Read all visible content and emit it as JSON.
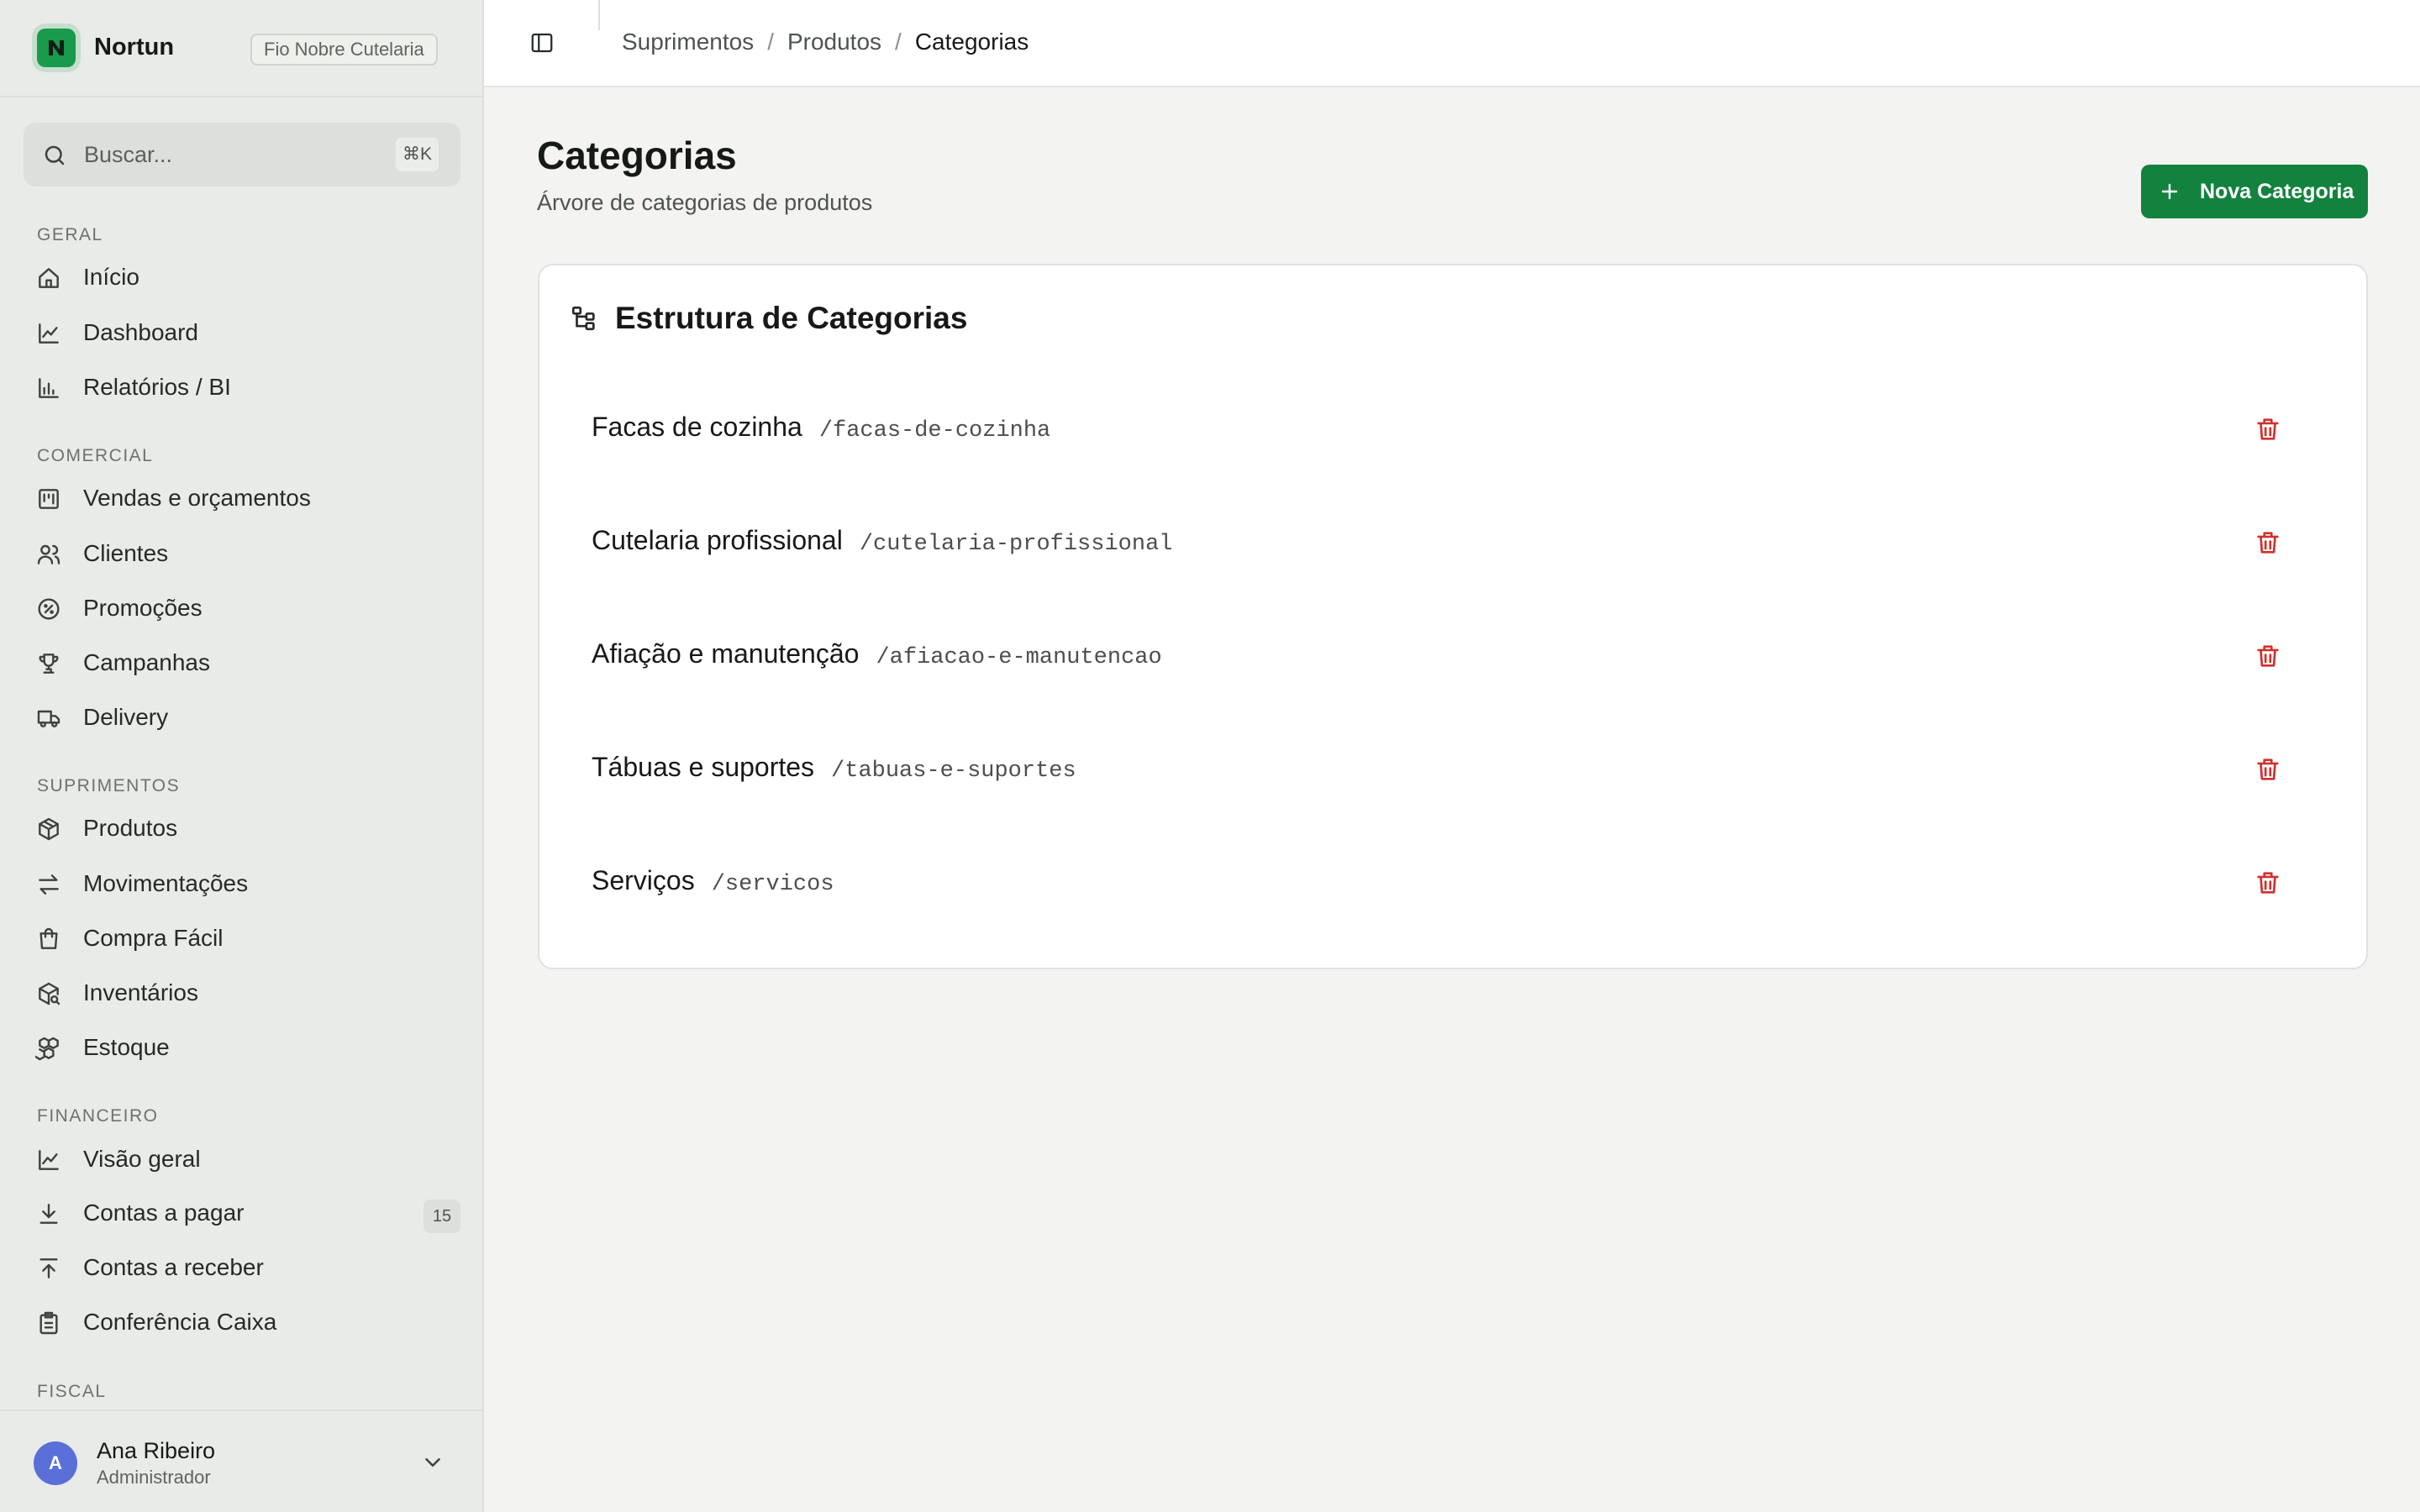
{
  "brand": {
    "name": "Nortun",
    "org": "Fio Nobre Cutelaria"
  },
  "search": {
    "placeholder": "Buscar...",
    "shortcut": "⌘K"
  },
  "sidebar": {
    "sections": [
      {
        "title": "GERAL",
        "items": [
          {
            "label": "Início",
            "icon": "home-icon"
          },
          {
            "label": "Dashboard",
            "icon": "chart-line-icon"
          },
          {
            "label": "Relatórios / BI",
            "icon": "bar-chart-icon"
          }
        ]
      },
      {
        "title": "COMERCIAL",
        "items": [
          {
            "label": "Vendas e orçamentos",
            "icon": "kanban-icon"
          },
          {
            "label": "Clientes",
            "icon": "users-icon"
          },
          {
            "label": "Promoções",
            "icon": "discount-icon"
          },
          {
            "label": "Campanhas",
            "icon": "trophy-icon"
          },
          {
            "label": "Delivery",
            "icon": "truck-icon"
          }
        ]
      },
      {
        "title": "SUPRIMENTOS",
        "items": [
          {
            "label": "Produtos",
            "icon": "package-icon"
          },
          {
            "label": "Movimentações",
            "icon": "arrows-exchange-icon"
          },
          {
            "label": "Compra Fácil",
            "icon": "shopping-bag-icon"
          },
          {
            "label": "Inventários",
            "icon": "package-search-icon"
          },
          {
            "label": "Estoque",
            "icon": "boxes-icon"
          }
        ]
      },
      {
        "title": "FINANCEIRO",
        "items": [
          {
            "label": "Visão geral",
            "icon": "chart-line-icon"
          },
          {
            "label": "Contas a pagar",
            "icon": "download-icon",
            "badge": "15"
          },
          {
            "label": "Contas a receber",
            "icon": "upload-icon"
          },
          {
            "label": "Conferência Caixa",
            "icon": "clipboard-list-icon"
          }
        ]
      },
      {
        "title": "FISCAL",
        "items": []
      }
    ]
  },
  "user": {
    "initial": "A",
    "name": "Ana Ribeiro",
    "role": "Administrador"
  },
  "breadcrumb": [
    "Suprimentos",
    "Produtos",
    "Categorias"
  ],
  "page": {
    "title": "Categorias",
    "subtitle": "Árvore de categorias de produtos",
    "new_button": "Nova Categoria"
  },
  "card": {
    "title": "Estrutura de Categorias",
    "categories": [
      {
        "name": "Facas de cozinha",
        "slug": "/facas-de-cozinha"
      },
      {
        "name": "Cutelaria profissional",
        "slug": "/cutelaria-profissional"
      },
      {
        "name": "Afiação e manutenção",
        "slug": "/afiacao-e-manutencao"
      },
      {
        "name": "Tábuas e suportes",
        "slug": "/tabuas-e-suportes"
      },
      {
        "name": "Serviços",
        "slug": "/servicos"
      }
    ]
  },
  "colors": {
    "accent": "#13823f",
    "danger": "#d0312d",
    "sidebar_bg": "#e8ebe7",
    "page_bg": "#f3f4f1"
  }
}
